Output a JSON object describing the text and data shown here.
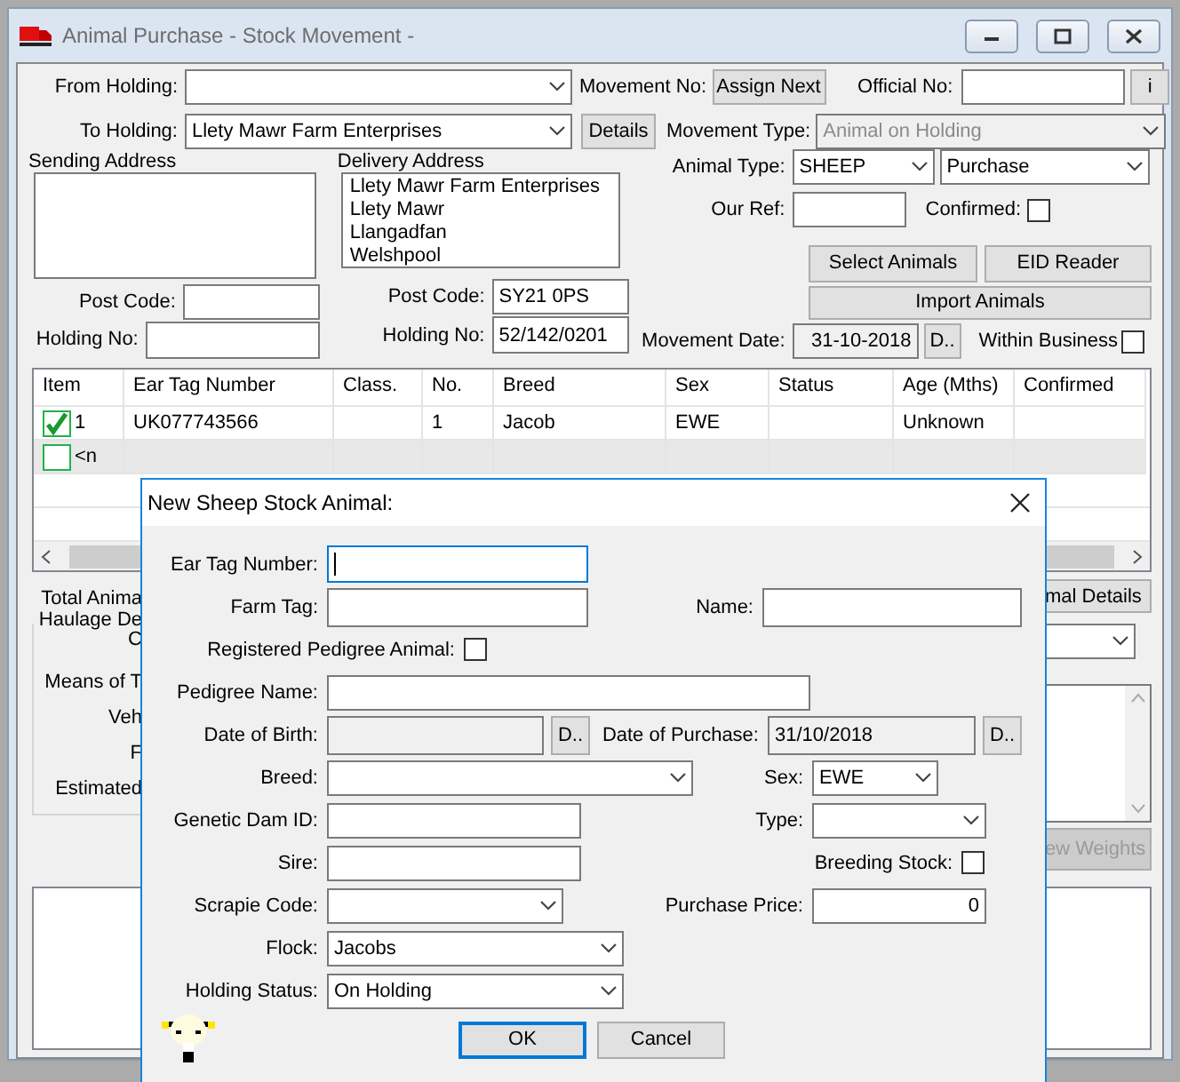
{
  "window": {
    "title": "Animal Purchase - Stock Movement -"
  },
  "movement": {
    "from_holding": {
      "label": "From Holding:"
    },
    "movement_no": {
      "label": "Movement No:",
      "button": "Assign Next"
    },
    "official_no": {
      "label": "Official No:",
      "button": "i"
    },
    "to_holding": {
      "label": "To Holding:",
      "value": "Llety Mawr Farm Enterprises",
      "button": "Details"
    },
    "movement_type": {
      "label": "Movement Type:",
      "value": "Animal on Holding",
      "disabled": true
    },
    "sending_address": {
      "label": "Sending Address",
      "post_code_label": "Post Code:",
      "holding_no_label": "Holding No:"
    },
    "delivery_address": {
      "label": "Delivery Address",
      "lines": [
        "Llety Mawr Farm Enterprises",
        "Llety Mawr",
        "Llangadfan",
        "Welshpool"
      ],
      "post_code_label": "Post Code:",
      "post_code": "SY21 0PS",
      "holding_no_label": "Holding No:",
      "holding_no": "52/142/0201"
    },
    "animal_type": {
      "label": "Animal Type:",
      "value": "SHEEP",
      "purpose": "Purchase"
    },
    "our_ref": {
      "label": "Our Ref:"
    },
    "confirmed": {
      "label": "Confirmed:",
      "checked": false
    },
    "buttons": [
      "Select Animals",
      "EID Reader",
      "Import Animals"
    ],
    "movement_date": {
      "label": "Movement Date:",
      "value": "31-10-2018",
      "button": "D.."
    },
    "within_business": {
      "label": "Within Business",
      "checked": false
    }
  },
  "grid": {
    "columns": [
      "Item",
      "Ear Tag Number",
      "Class.",
      "No.",
      "Breed",
      "Sex",
      "Status",
      "Age (Mths)",
      "Confirmed"
    ],
    "rows": [
      {
        "checked": true,
        "selected": false,
        "item": "1",
        "ear_tag_number": "UK077743566",
        "no": "1",
        "breed": "Jacob",
        "sex": "EWE",
        "age_mths": "Unknown"
      },
      {
        "checked": false,
        "selected": true,
        "item": "<n"
      }
    ]
  },
  "details": {
    "total_animals_label": "Total Anima",
    "haulage_title": "Haulage De",
    "haulage_labels": [
      "C",
      "Means of T",
      "Veh",
      "F",
      "Estimated"
    ],
    "animal_details_button": "mal Details",
    "weights_button": {
      "label": "ew Weights",
      "disabled": true
    }
  },
  "dialog": {
    "title": "New Sheep Stock Animal:",
    "ear_tag_number": {
      "label": "Ear Tag Number:",
      "focused": true
    },
    "farm_tag": {
      "label": "Farm Tag:"
    },
    "name": {
      "label": "Name:"
    },
    "registered_pedigree": {
      "label": "Registered Pedigree Animal:",
      "checked": false
    },
    "pedigree_name": {
      "label": "Pedigree Name:"
    },
    "date_of_birth": {
      "label": "Date of Birth:",
      "button": "D..",
      "disabled": true
    },
    "date_of_purchase": {
      "label": "Date of Purchase:",
      "value": "31/10/2018",
      "button": "D..",
      "disabled": true
    },
    "breed": {
      "label": "Breed:"
    },
    "sex": {
      "label": "Sex:",
      "value": "EWE"
    },
    "genetic_dam_id": {
      "label": "Genetic Dam ID:"
    },
    "type": {
      "label": "Type:"
    },
    "sire": {
      "label": "Sire:"
    },
    "breeding_stock": {
      "label": "Breeding Stock:",
      "checked": false
    },
    "scrapie_code": {
      "label": "Scrapie Code:"
    },
    "purchase_price": {
      "label": "Purchase Price:",
      "value": "0"
    },
    "flock": {
      "label": "Flock:",
      "value": "Jacobs"
    },
    "holding_status": {
      "label": "Holding Status:",
      "value": "On Holding"
    },
    "buttons": [
      {
        "label": "OK",
        "default": true
      },
      {
        "label": "Cancel",
        "default": false
      }
    ]
  }
}
